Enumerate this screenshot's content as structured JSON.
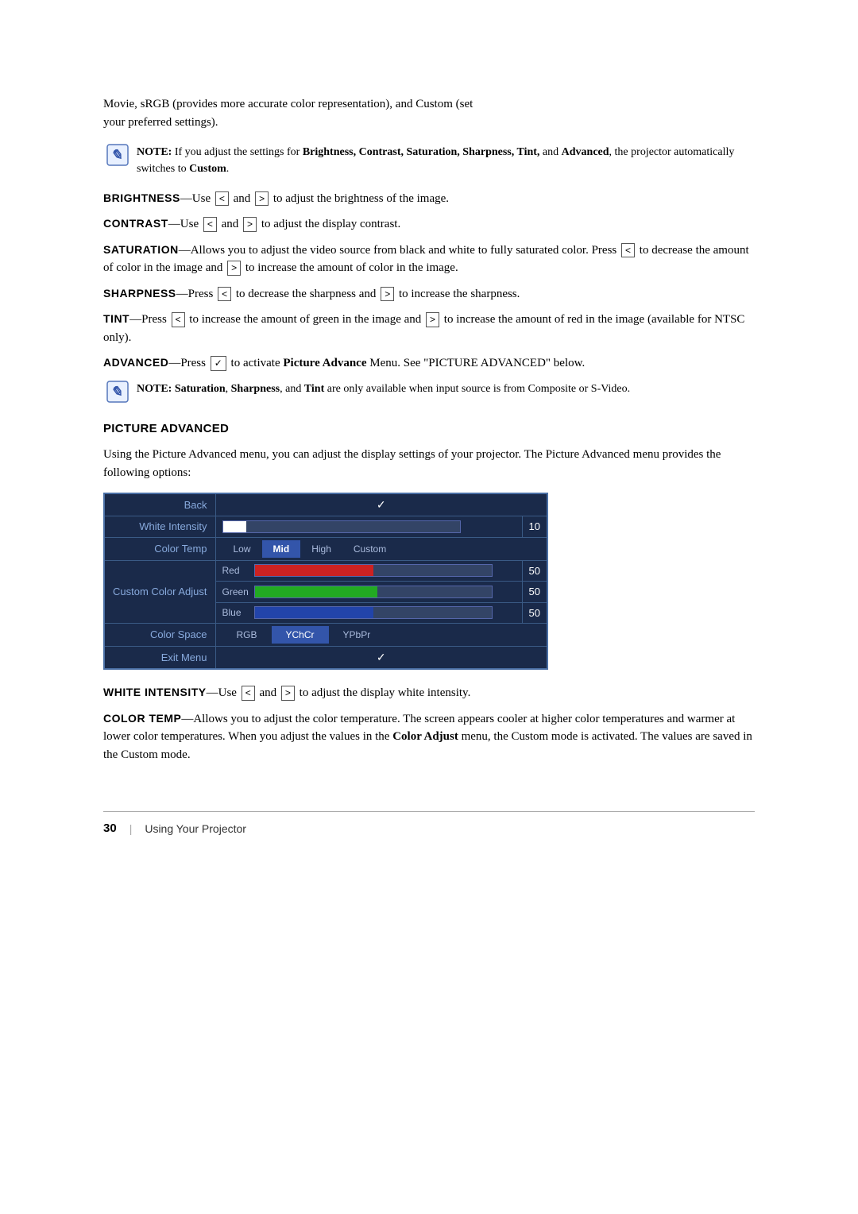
{
  "page": {
    "number": "30",
    "footer_text": "Using Your Projector"
  },
  "intro": {
    "line1": "Movie, sRGB (provides more accurate color representation), and Custom (set",
    "line2": "your preferred settings)."
  },
  "note1": {
    "label": "NOTE:",
    "text": "If you adjust the settings for Brightness, Contrast, Saturation, Sharpness, Tint, and Advanced, the projector automatically switches to Custom."
  },
  "params": [
    {
      "id": "brightness",
      "label": "Brightness",
      "em_dash": "—",
      "text_before": "Use ",
      "btn_left": "<",
      "text_mid": " and ",
      "btn_right": ">",
      "text_after": " to adjust the brightness of the image."
    },
    {
      "id": "contrast",
      "label": "Contrast",
      "em_dash": "—",
      "text_before": "Use ",
      "btn_left": "<",
      "text_mid": " and ",
      "btn_right": ">",
      "text_after": " to adjust the display contrast."
    },
    {
      "id": "saturation",
      "label": "Saturation",
      "em_dash": "—",
      "text_before": "Allows you to adjust the video source from black and white to fully saturated color. Press ",
      "btn_left": "<",
      "text_mid": " to decrease the amount of color in the image and ",
      "btn_right": ">",
      "text_after": " to increase the amount of color in the image."
    },
    {
      "id": "sharpness",
      "label": "Sharpness",
      "em_dash": "—",
      "text_before": "Press ",
      "btn_left": "<",
      "text_mid": " to decrease the sharpness and ",
      "btn_right": ">",
      "text_after": " to increase the sharpness."
    },
    {
      "id": "tint",
      "label": "Tint",
      "em_dash": "—",
      "text_before": "Press ",
      "btn_left": "<",
      "text_mid": " to increase the amount of green in the image and ",
      "btn_right": ">",
      "text_after": " to increase the amount of red in the image (available for NTSC only)."
    },
    {
      "id": "advanced",
      "label": "Advanced",
      "em_dash": "—",
      "text_before": "Press ",
      "btn_symbol": "✓",
      "text_after": " to activate Picture Advance Menu. See \"PICTURE ADVANCED\" below."
    }
  ],
  "note2": {
    "label": "NOTE:",
    "text": "Saturation, Sharpness, and Tint are only available when input source is from Composite or S-Video."
  },
  "section": {
    "heading": "PICTURE ADVANCED",
    "intro": "Using the Picture Advanced menu, you can adjust the display settings of your projector. The Picture Advanced menu provides the following options:"
  },
  "menu": {
    "rows": [
      {
        "type": "back",
        "label": "Back",
        "value": "✓"
      },
      {
        "type": "white_intensity",
        "label": "White Intensity",
        "value_type": "slider_white",
        "value_num": "10"
      },
      {
        "type": "color_temp",
        "label": "Color Temp",
        "options": [
          "Low",
          "Mid",
          "High",
          "Custom"
        ],
        "selected": "Mid"
      },
      {
        "type": "custom_color_adjust",
        "label": "Custom Color Adjust",
        "subrows": [
          {
            "sublabel": "Red",
            "fill": "red",
            "value": "50"
          },
          {
            "sublabel": "Green",
            "fill": "green",
            "value": "50"
          },
          {
            "sublabel": "Blue",
            "fill": "blue",
            "value": "50"
          }
        ]
      },
      {
        "type": "color_space",
        "label": "Color Space",
        "options": [
          "RGB",
          "YChCr",
          "YPbPr"
        ],
        "selected": "YChCr"
      },
      {
        "type": "exit",
        "label": "Exit Menu",
        "value": "✓"
      }
    ]
  },
  "white_intensity": {
    "label": "White Intensity",
    "em_dash": "—",
    "text_before": "Use ",
    "btn_left": "<",
    "text_mid": " and ",
    "btn_right": ">",
    "text_after": " to adjust the display white intensity."
  },
  "color_temp": {
    "label": "Color Temp",
    "em_dash": "—",
    "text": "Allows you to adjust the color temperature. The screen appears cooler at higher color temperatures and warmer at lower color temperatures. When you adjust the values in the Color Adjust menu, the Custom mode is activated. The values are saved in the Custom mode."
  }
}
